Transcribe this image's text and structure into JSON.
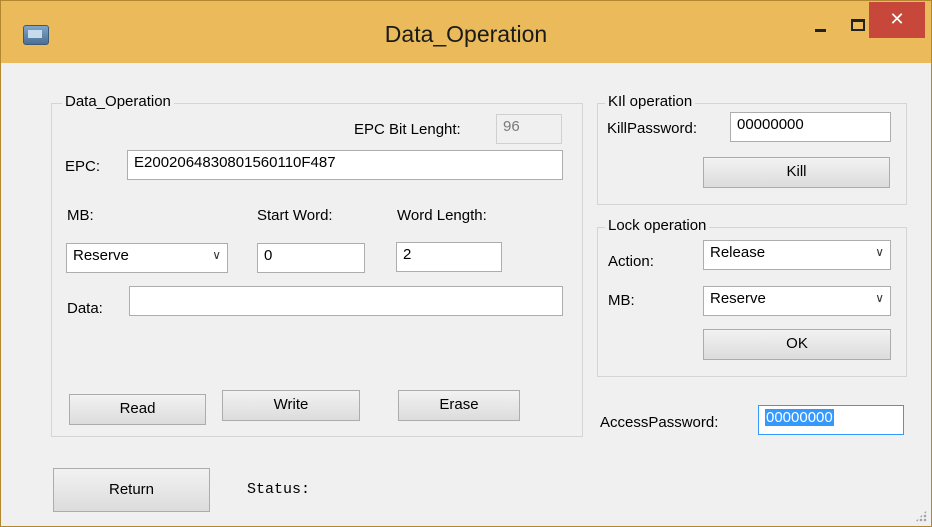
{
  "window": {
    "title": "Data_Operation",
    "close_glyph": "✕",
    "title_bar_color": "#eaba5b"
  },
  "data_group": {
    "legend": "Data_Operation",
    "epc_bit_length_label": "EPC Bit Lenght:",
    "epc_bit_length_value": "96",
    "epc_label": "EPC:",
    "epc_value": "E2002064830801560110F487",
    "mb_label": "MB:",
    "start_word_label": "Start Word:",
    "word_length_label": "Word Length:",
    "mb_selected": "Reserve",
    "start_word_value": "0",
    "word_length_value": "2",
    "data_label": "Data:",
    "data_value": "",
    "read_button": "Read",
    "write_button": "Write",
    "erase_button": "Erase"
  },
  "kill_group": {
    "legend": "KIl operation",
    "password_label": "KillPassword:",
    "password_value": "00000000",
    "kill_button": "Kill"
  },
  "lock_group": {
    "legend": "Lock operation",
    "action_label": "Action:",
    "action_selected": "Release",
    "mb_label": "MB:",
    "mb_selected": "Reserve",
    "ok_button": "OK"
  },
  "access": {
    "label": "AccessPassword:",
    "value": "00000000"
  },
  "footer": {
    "return_button": "Return",
    "status_label": "Status:"
  }
}
